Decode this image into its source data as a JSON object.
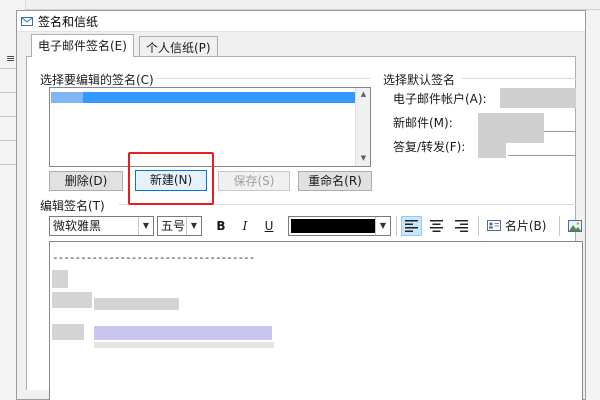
{
  "window": {
    "title": "签名和信纸"
  },
  "tabs": [
    {
      "label": "电子邮件签名(E)",
      "active": true
    },
    {
      "label": "个人信纸(P)",
      "active": false
    }
  ],
  "select_signature": {
    "label": "选择要编辑的签名(C)",
    "selected_index": 0
  },
  "buttons": {
    "delete": "删除(D)",
    "new": "新建(N)",
    "save": "保存(S)",
    "rename": "重命名(R)"
  },
  "default_signature": {
    "label": "选择默认签名",
    "account_label": "电子邮件帐户(A):",
    "new_messages_label": "新邮件(M):",
    "replies_label": "答复/转发(F):"
  },
  "edit_signature": {
    "label": "编辑签名(T)",
    "font_name": "微软雅黑",
    "font_size": "五号",
    "bold_label": "B",
    "italic_label": "I",
    "underline_label": "U",
    "font_color": "#000000",
    "business_card_label": "名片(B)",
    "content_first_line": "------------------------------------"
  },
  "background": {
    "left_tick": "≡"
  },
  "colors": {
    "selection": "#3399ff",
    "highlight_box": "#e81e1e",
    "dialog_bg": "#f0f0f0"
  },
  "icons": [
    "envelope-icon",
    "align-left-icon",
    "align-center-icon",
    "align-right-icon",
    "business-card-icon",
    "picture-icon"
  ]
}
